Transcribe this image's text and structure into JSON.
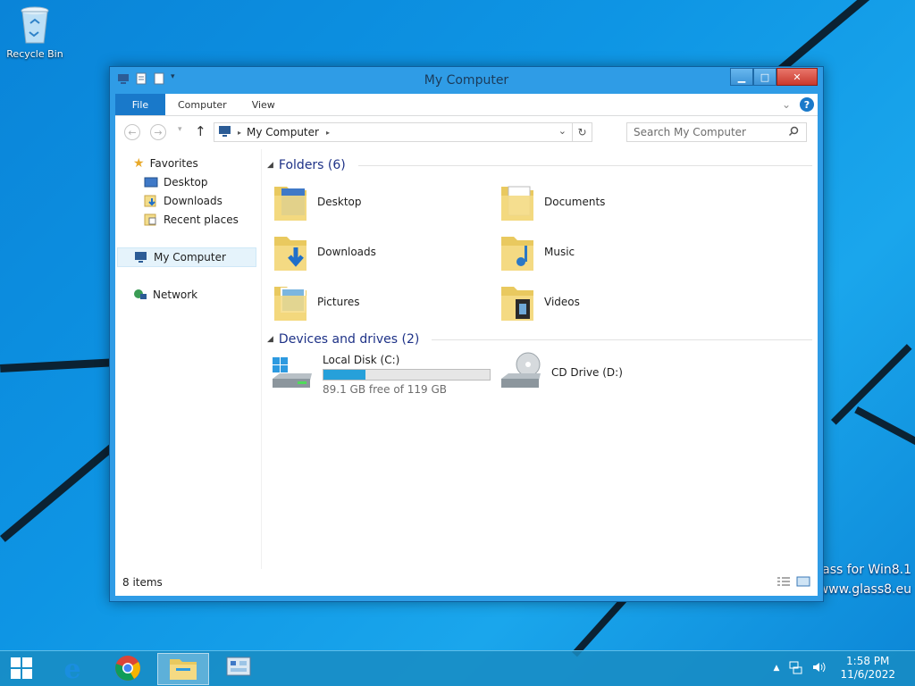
{
  "desktop": {
    "recycle_bin_label": "Recycle Bin",
    "watermark_line1": "lass for Win8.1",
    "watermark_line2": "www.glass8.eu"
  },
  "window": {
    "title": "My Computer",
    "ribbon_tabs": [
      "File",
      "Computer",
      "View"
    ],
    "address": {
      "path": "My Computer"
    },
    "search": {
      "placeholder": "Search My Computer"
    }
  },
  "nav_pane": {
    "favorites_label": "Favorites",
    "favorites": [
      "Desktop",
      "Downloads",
      "Recent places"
    ],
    "computer_label": "My Computer",
    "network_label": "Network"
  },
  "folders": {
    "header": "Folders (6)",
    "items": [
      "Desktop",
      "Documents",
      "Downloads",
      "Music",
      "Pictures",
      "Videos"
    ]
  },
  "devices": {
    "header": "Devices and drives (2)",
    "local_disk": {
      "label": "Local Disk (C:)",
      "free_text": "89.1 GB free of 119 GB",
      "used_fraction": 0.25
    },
    "cd_drive": {
      "label": "CD Drive (D:)"
    }
  },
  "status": {
    "items_text": "8 items"
  },
  "taskbar": {
    "time": "1:58 PM",
    "date": "11/6/2022"
  },
  "colors": {
    "accent": "#1979ca",
    "selection": "#e5f3fb",
    "group_header": "#1e3287",
    "progress": "#26a0da"
  }
}
